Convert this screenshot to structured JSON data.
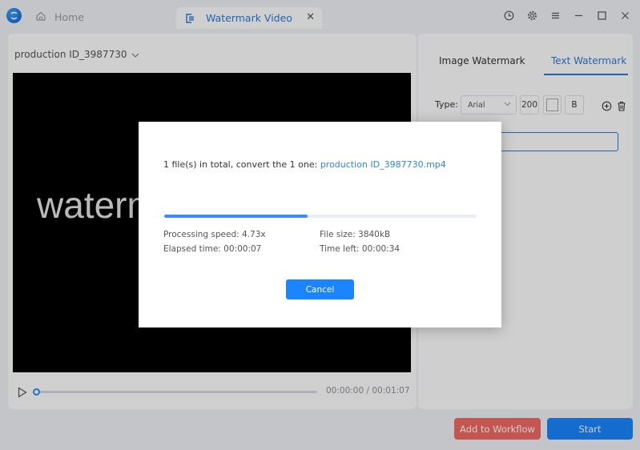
{
  "app": {
    "logo_icon": "app-logo-icon",
    "tabs": [
      {
        "label": "Home",
        "icon": "home-icon",
        "active": false
      },
      {
        "label": "Watermark Video",
        "icon": "watermark-video-icon",
        "active": true,
        "close_icon": "close-icon"
      }
    ],
    "window_controls": [
      "history-icon",
      "settings-icon",
      "menu-icon",
      "minimize-icon",
      "maximize-icon",
      "close-icon"
    ],
    "window_control_glyphs": {
      "history": "◷",
      "settings": "⚙",
      "menu": "≡",
      "minimize": "—",
      "maximize": "☐",
      "close": "✕"
    }
  },
  "left_panel": {
    "file_select": {
      "value": "production ID_3987730",
      "icon": "chevron-down-icon"
    },
    "video_overlay_text": "watermark",
    "player": {
      "play_icon": "play-icon",
      "current_time": "00:00:00",
      "duration": "00:01:07",
      "timecode": "00:00:00 / 00:01:07",
      "position": 0
    }
  },
  "right_panel": {
    "tabs": [
      {
        "label": "Image Watermark",
        "active": false
      },
      {
        "label": "Text Watermark",
        "active": true
      }
    ],
    "type_label": "Type:",
    "font": "Arial",
    "font_size": "200",
    "text_color": "#ffffff",
    "bold_label": "B",
    "add_icon": "add-circle-icon",
    "delete_icon": "trash-icon",
    "text_value": "watermark"
  },
  "actions": {
    "add_to_workflow": "Add to Workflow",
    "start": "Start"
  },
  "dialog": {
    "message_prefix": "1 file(s) in total, convert the 1 one: ",
    "file_name": "production ID_3987730.mp4",
    "progress": 0.46,
    "processing_speed": "Processing speed: 4.73x",
    "file_size": "File size: 3840kB",
    "elapsed_time": "Elapsed time: 00:00:07",
    "time_left": "Time left: 00:00:34",
    "cancel": "Cancel"
  },
  "colors": {
    "accent": "#1a85ff",
    "tab_active_text": "#2b7bd6",
    "workflow_button": "#f06b63",
    "progress_fill": "#3a8ef0"
  }
}
